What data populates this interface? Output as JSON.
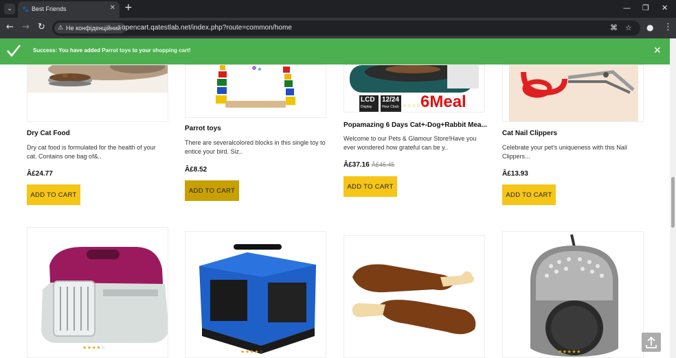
{
  "browser": {
    "tab_menu_icon": "chevron-down-icon",
    "tab_title": "Best Friends",
    "tab_close": "✕",
    "new_tab": "+",
    "window": {
      "minimize": "—",
      "maximize": "❐",
      "close": "✕"
    },
    "security_label": "Не конфіденційний",
    "url": "opencart.qatestlab.net/index.php?route=common/home"
  },
  "alert": {
    "prefix": "Success: You have added ",
    "product_link": "Parrot toys",
    "middle": " to your ",
    "cart_link": "shopping cart",
    "suffix": "!",
    "close": "✕",
    "color": "#4caf50"
  },
  "products_row1": [
    {
      "name": "Dry Cat Food",
      "desc": "Dry cat food is formulated for the health of your cat. Contains one bag of&..",
      "price": "Â£24.77",
      "old_price": "",
      "button": "ADD TO CART"
    },
    {
      "name": "Parrot toys",
      "desc": "There are severalcolored blocks in this single toy to entice your bird. Siz..",
      "price": "Â£8.52",
      "old_price": "",
      "button": "ADD TO CART"
    },
    {
      "name": "Popamazing 6 Days Cat+-Dog+Rabbit Mea...",
      "desc": "Welcome to our Pets & Glamour Store!Have you ever wondered how grateful can be y..",
      "price": "Â£37.16",
      "old_price": "Â£46.45",
      "button": "ADD TO CART",
      "img_text_lcd": "LCD",
      "img_text_lcd_sub": "Display",
      "img_text_clock": "12/24",
      "img_text_clock_sub": "Hour Clock",
      "img_text_meal": "6Meal"
    },
    {
      "name": "Cat Nail Clippers",
      "desc": "Celebrate your pet's uniqueness with this Nail Clippers...",
      "price": "Â£13.93",
      "old_price": "",
      "button": "ADD TO CART"
    }
  ],
  "ratings_row2": [
    {
      "stars": "★★★★☆",
      "rating": 4
    },
    {
      "stars": "★★★★☆",
      "rating": 4
    },
    {
      "stars": "",
      "rating": 0
    },
    {
      "stars": "★★★★★",
      "rating": 5
    }
  ],
  "colors": {
    "accent": "#f5c518",
    "accent_hover": "#c9a004",
    "success": "#4caf50"
  }
}
